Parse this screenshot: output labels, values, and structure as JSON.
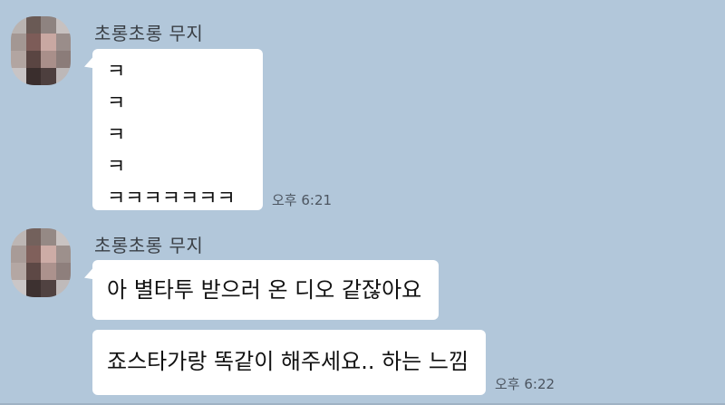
{
  "chat": {
    "groups": [
      {
        "sender": "초롱초롱 무지",
        "messages": [
          "ㅋ",
          "ㅋ",
          "ㅋ",
          "ㅋ",
          "ㅋㅋㅋㅋㅋㅋㅋ"
        ],
        "time": "오후 6:21"
      },
      {
        "sender": "초롱초롱 무지",
        "messages": [
          "아 별타투 받으러 온 디오 같잖아요",
          "죠스타가랑 똑같이 해주세요.. 하는 느낌"
        ],
        "time": "오후 6:22"
      }
    ]
  },
  "colors": {
    "background": "#b2c7da",
    "bubble": "#ffffff"
  }
}
